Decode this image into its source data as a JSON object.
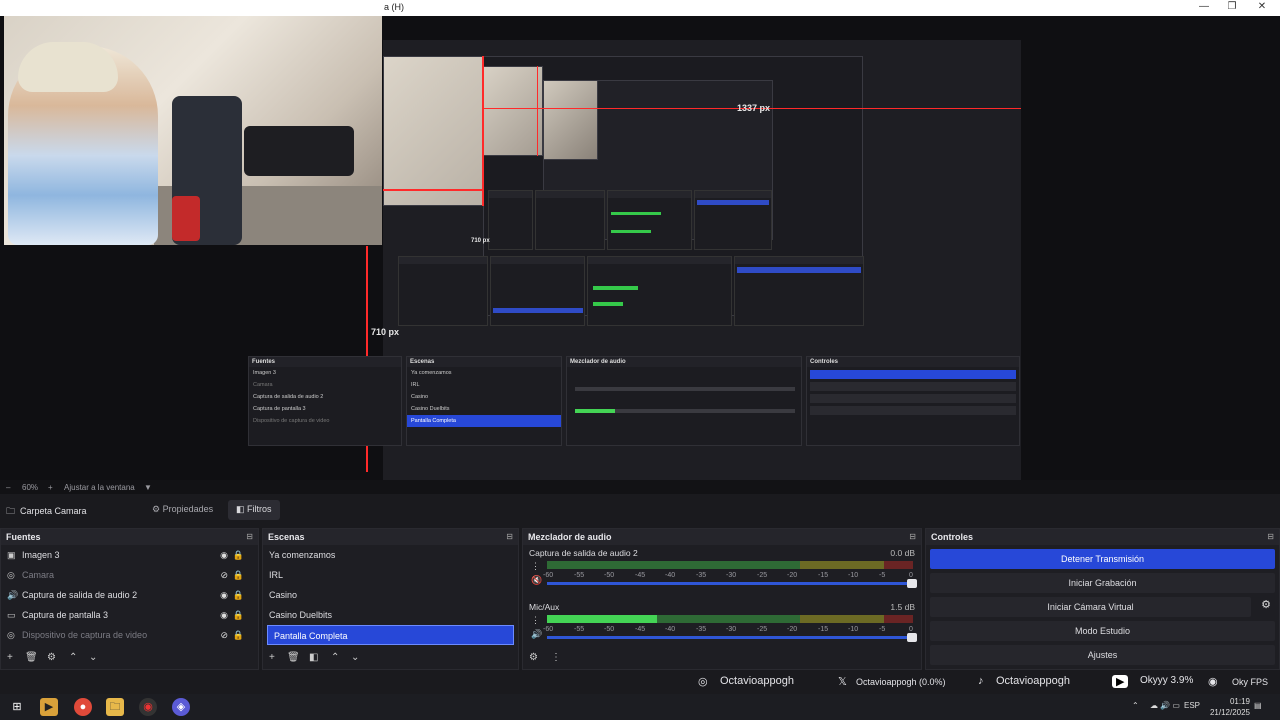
{
  "window": {
    "title_fragment": "a (H)",
    "controls": [
      "—",
      "❐",
      "✕"
    ]
  },
  "preview": {
    "measure_w": "1337 px",
    "measure_h": "710 px",
    "inner_measure_h": "710 px"
  },
  "zoom": {
    "percent": "60%",
    "fit": "Ajustar a la ventana"
  },
  "context": {
    "source_name": "Carpeta Camara",
    "properties": "Propiedades",
    "filters": "Filtros"
  },
  "sources": {
    "title": "Fuentes",
    "items": [
      {
        "label": "Imagen 3",
        "icon": "▣",
        "dim": false,
        "visible": "◉"
      },
      {
        "label": "Camara",
        "icon": "◎",
        "dim": true,
        "visible": "⊘"
      },
      {
        "label": "Captura de salida de audio 2",
        "icon": "🔊",
        "dim": false,
        "visible": "◉"
      },
      {
        "label": "Captura de pantalla 3",
        "icon": "▭",
        "dim": false,
        "visible": "◉"
      },
      {
        "label": "Dispositivo de captura de video",
        "icon": "◎",
        "dim": true,
        "visible": "⊘"
      }
    ]
  },
  "scenes": {
    "title": "Escenas",
    "items": [
      "Ya comenzamos",
      "IRL",
      "Casino",
      "Casino Duelbits",
      "Pantalla Completa"
    ],
    "selected": 4
  },
  "mixer": {
    "title": "Mezclador de audio",
    "channels": [
      {
        "name": "Captura de salida de audio 2",
        "db": "0.0 dB",
        "level": 0.0,
        "muted": true
      },
      {
        "name": "Mic/Aux",
        "db": "1.5 dB",
        "level": 0.3,
        "muted": false
      }
    ],
    "ticks": [
      "-60",
      "-55",
      "-50",
      "-45",
      "-40",
      "-35",
      "-30",
      "-25",
      "-20",
      "-15",
      "-10",
      "-5",
      "0"
    ]
  },
  "controls": {
    "title": "Controles",
    "stop_stream": "Detener Transmisión",
    "start_record": "Iniciar Grabación",
    "virtual_cam": "Iniciar Cámara Virtual",
    "studio_mode": "Modo Estudio",
    "settings": "Ajustes"
  },
  "socials": {
    "instagram": "Octavioappogh",
    "x": "Octavioappogh (0.0%)",
    "tiktok": "Octavioappogh",
    "youtube": "Okyyy 3.9%",
    "spotify": "Oky FPS"
  },
  "tray": {
    "lang": "ESP",
    "time": "01:19",
    "date": "21/12/2025"
  },
  "colors": {
    "accent": "#2748d8",
    "meter_green": "#44d455",
    "marker_red": "#ff2a2a"
  }
}
